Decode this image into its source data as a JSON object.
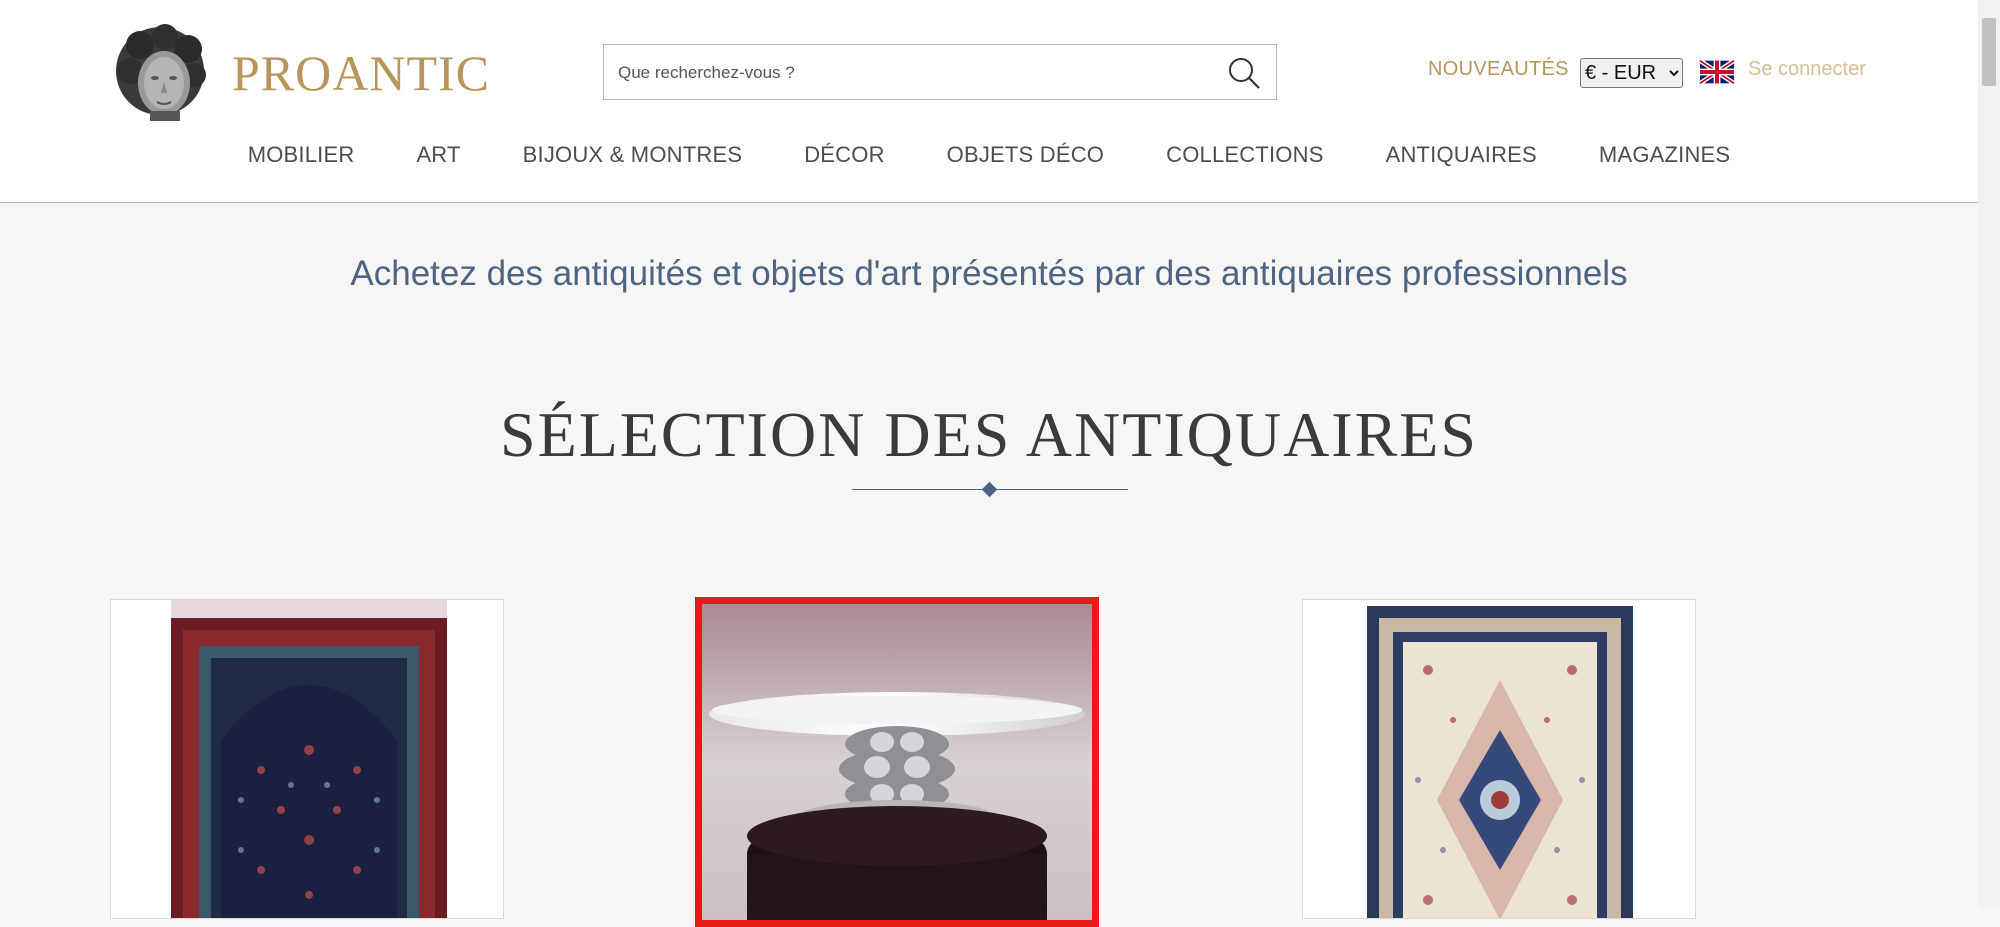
{
  "header": {
    "logo_text": "PROANTIC",
    "search": {
      "placeholder": "Que recherchez-vous ?"
    },
    "nouveautes_label": "NOUVEAUTÉS",
    "currency": {
      "selected": "€ - EUR"
    },
    "language_flag": "uk-flag-icon",
    "login_label": "Se connecter"
  },
  "nav": {
    "items": [
      {
        "label": "MOBILIER"
      },
      {
        "label": "ART"
      },
      {
        "label": "BIJOUX & MONTRES"
      },
      {
        "label": "DÉCOR"
      },
      {
        "label": "OBJETS DÉCO"
      },
      {
        "label": "COLLECTIONS"
      },
      {
        "label": "ANTIQUAIRES"
      },
      {
        "label": "MAGAZINES"
      }
    ]
  },
  "main": {
    "tagline": "Achetez des antiquités et objets d'art présentés par des antiquaires professionnels",
    "section_title": "SÉLECTION DES ANTIQUAIRES"
  },
  "colors": {
    "brand_gold": "#b8955a",
    "accent_blue": "#4e6485",
    "highlight_red": "#e8191a"
  }
}
